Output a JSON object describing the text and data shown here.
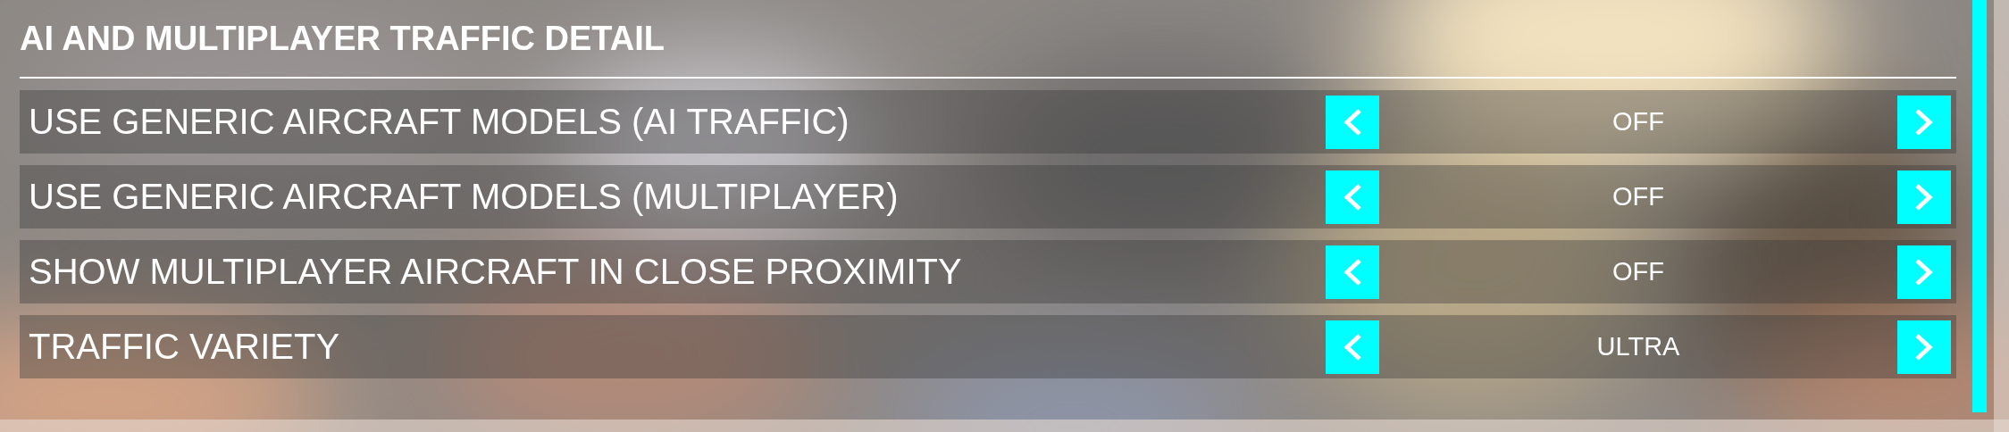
{
  "section": {
    "title": "AI AND MULTIPLAYER TRAFFIC DETAIL"
  },
  "settings": [
    {
      "label": "USE GENERIC AIRCRAFT MODELS (AI TRAFFIC)",
      "value": "OFF"
    },
    {
      "label": "USE GENERIC AIRCRAFT MODELS (MULTIPLAYER)",
      "value": "OFF"
    },
    {
      "label": "SHOW MULTIPLAYER AIRCRAFT IN CLOSE PROXIMITY",
      "value": "OFF"
    },
    {
      "label": "TRAFFIC VARIETY",
      "value": "ULTRA"
    }
  ]
}
